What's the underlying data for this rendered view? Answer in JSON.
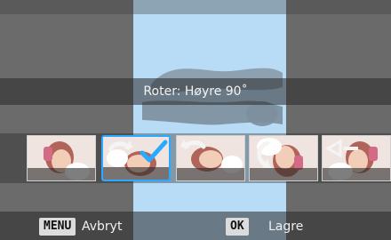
{
  "title": "Roter: Høyre 90˚",
  "actions": {
    "menu_key": "MENU",
    "menu_label": "Avbryt",
    "ok_key": "OK",
    "ok_label": "Lagre"
  },
  "thumbnails": [
    {
      "label": "original",
      "overlay": "none"
    },
    {
      "label": "rotate-right-90",
      "overlay": "rotate-right-arrow"
    },
    {
      "label": "rotate-left-90",
      "overlay": "rotate-left-arrow"
    },
    {
      "label": "rotate-180",
      "overlay": "rotate-arrow"
    },
    {
      "label": "flip-horizontal",
      "overlay": "flip-arrow"
    }
  ],
  "selected_thumbnail": 1,
  "colors": {
    "selection": "#29a9ff",
    "preview_bg": "#b8dcf5"
  }
}
